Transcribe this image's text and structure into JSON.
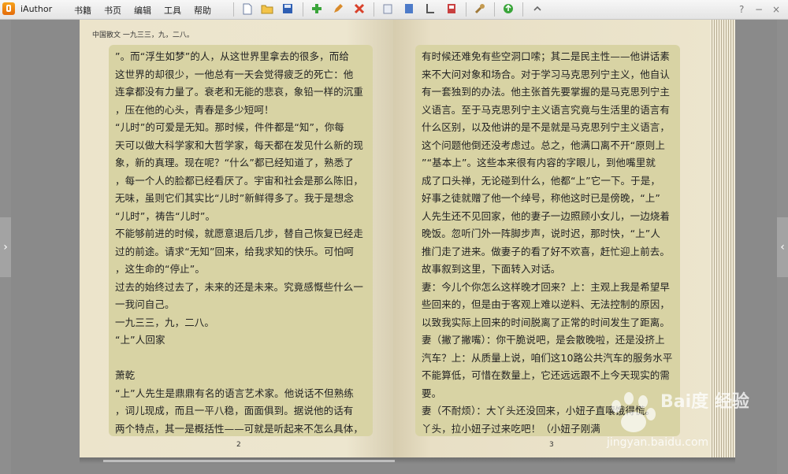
{
  "app": {
    "name": "iAuthor"
  },
  "menu": [
    "书籍",
    "书页",
    "编辑",
    "工具",
    "帮助"
  ],
  "toolbar_icons": [
    "new-file-icon",
    "open-folder-icon",
    "save-icon",
    "add-icon",
    "edit-pencil-icon",
    "delete-x-icon",
    "page-layout-icon",
    "book-icon",
    "corner-icon",
    "export-icon",
    "wrench-icon",
    "go-icon",
    "collapse-icon"
  ],
  "window_controls": {
    "help": "?",
    "minimize": "−",
    "close": "×"
  },
  "book": {
    "running_head": "中国散文 一九三三，九，二八。",
    "left_page_number": "2",
    "right_page_number": "3",
    "left_lines": [
      "”。而“浮生如梦”的人，从这世界里拿去的很多，而给",
      "这世界的却很少，一他总有一天会觉得疲乏的死亡：他",
      "连拿都没有力量了。衰老和无能的悲哀，象铅一样的沉重",
      "，压在他的心头，青春是多少短呵！",
      "“儿时”的可爱是无知。那时候，件件都是“知”，你每",
      "天可以做大科学家和大哲学家，每天都在发见什么新的现",
      "象，新的真理。现在呢？“什么”都已经知道了，熟悉了",
      "，每一个人的脸都已经看厌了。宇宙和社会是那么陈旧，",
      "无味，虽则它们其实比“儿时”新鲜得多了。我于是想念",
      "“儿时”，祷告“儿时”。",
      "不能够前进的时候，就愿意退后几步，替自己恢复已经走",
      "过的前途。请求“无知”回来，给我求知的快乐。可怕呵",
      "，这生命的“停止”。",
      "过去的始终过去了，未来的还是未来。究竟感慨些什么一",
      "一我问自己。",
      "一九三三，九，二八。",
      "“上”人回家",
      "",
      "萧乾",
      "“上”人先生是鼎鼎有名的语言艺术家。他说话不但熟练",
      "，词儿现成，而且一平八稳，面面俱到。据说他的话有",
      "两个特点，其一是概括性——可就是听起来不怎么具体，"
    ],
    "right_lines": [
      "有时候还难免有些空洞口嗦；其二是民主性——他讲话素",
      "来不大问对象和场合。对于学习马克思列宁主义，他自认",
      "有一套独到的办法。他主张首先要掌握的是马克思列宁主",
      "义语言。至于马克思列宁主义语言究竟与生活里的语言有",
      "什么区别，以及他讲的是不是就是马克思列宁主义语言，",
      "这个问题他倒还没考虑过。总之，他满口离不开“原则上",
      "”“基本上”。这些本来很有内容的字眼儿，到他嘴里就",
      "成了口头禅，无论碰到什么，他都“上”它一下。于是，",
      "好事之徒就赠了他一个绰号，称他这时已是傍晚，“上”",
      "人先生还不见回家，他的妻子一边照顾小女儿，一边烧着",
      "晚饭。忽听门外一阵脚步声，说时迟，那时快，“上”人",
      "推门走了进来。做妻子的看了好不欢喜，赶忙迎上前去。",
      "故事叙到这里，下面转入对话。",
      "妻：今儿个你怎么这样晚才回来？上：主观上我是希望早",
      "些回来的，但是由于客观上难以逆料、无法控制的原因，",
      "以致我实际上回来的时间脱离了正常的时间发生了距离。",
      "妻（撇了撇嘴）：你干脆说吧，是会散晚啦，还是没挤上",
      "汽车？上：从质量上说，咱们这10路公共汽车的服务水平",
      "不能算低，可惜在数量上，它还远远跟不上今天现实的需",
      "要。",
      "妻（不耐烦）：大丫头还没回来，小妞子直嚷饿得慌。",
      "丫头，拉小妞子过来吃吧！（小妞子刚满"
    ]
  },
  "watermark": {
    "brand": "Bai度 经验",
    "url": "jingyan.baidu.com"
  }
}
